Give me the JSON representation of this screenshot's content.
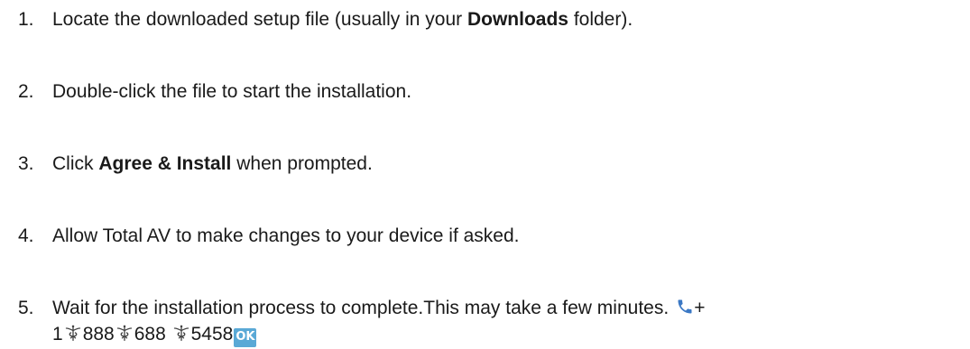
{
  "steps": [
    {
      "number": "1.",
      "text_before": "Locate the downloaded setup file (usually in your ",
      "bold": "Downloads",
      "text_after": " folder)."
    },
    {
      "number": "2.",
      "text": "Double-click the file to start the installation."
    },
    {
      "number": "3.",
      "text_before": "Click ",
      "bold": "Agree & Install",
      "text_after": " when prompted."
    },
    {
      "number": "4.",
      "text": "Allow Total AV to make changes to your device if asked."
    },
    {
      "number": "5.",
      "text": "Wait for the installation process to complete.This may take a few minutes.",
      "phone": {
        "icon": "telephone-receiver-icon",
        "plus": "+",
        "parts": [
          "1",
          "888",
          "688 ",
          "5458"
        ],
        "separator_icon": "caduceus-icon",
        "badge": "OK"
      }
    }
  ],
  "colors": {
    "text": "#1a1a1a",
    "phone_icon": "#3b78c4",
    "separator_icon": "#444444",
    "badge_bg": "#5aa9d6",
    "badge_text": "#ffffff"
  }
}
